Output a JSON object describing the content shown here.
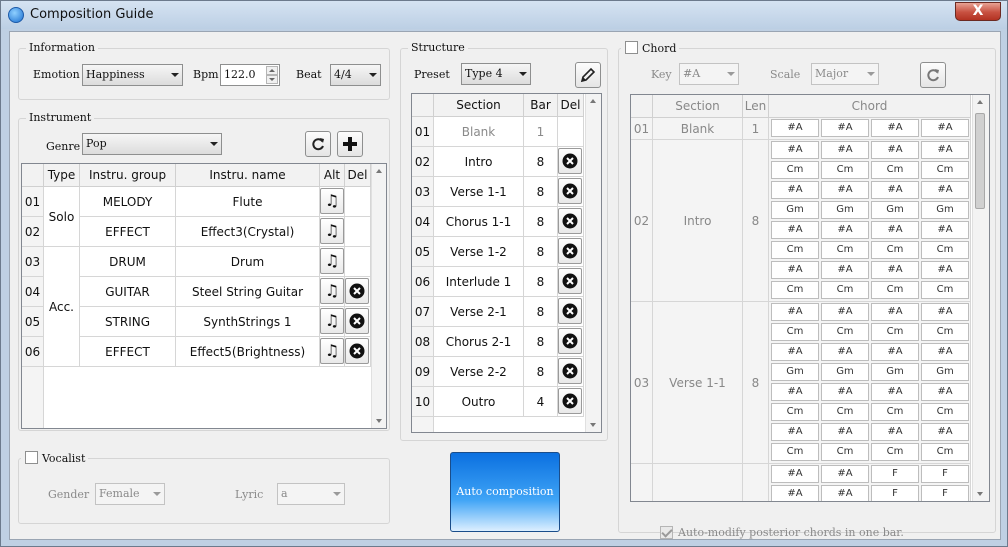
{
  "window": {
    "title": "Composition Guide",
    "close_label": "X"
  },
  "information": {
    "title": "Information",
    "emotion_label": "Emotion",
    "emotion_value": "Happiness",
    "bpm_label": "Bpm",
    "bpm_value": "122.0",
    "beat_label": "Beat",
    "beat_value": "4/4"
  },
  "instrument": {
    "title": "Instrument",
    "genre_label": "Genre",
    "genre_value": "Pop",
    "columns": [
      "Type",
      "Instru. group",
      "Instru. name",
      "Alt",
      "Del"
    ],
    "type_groups": [
      "Solo",
      "Acc."
    ],
    "rows": [
      {
        "no": "01",
        "group": "MELODY",
        "name": "Flute",
        "del": false
      },
      {
        "no": "02",
        "group": "EFFECT",
        "name": "Effect3(Crystal)",
        "del": false
      },
      {
        "no": "03",
        "group": "DRUM",
        "name": "Drum",
        "del": false
      },
      {
        "no": "04",
        "group": "GUITAR",
        "name": "Steel String Guitar",
        "del": true
      },
      {
        "no": "05",
        "group": "STRING",
        "name": "SynthStrings 1",
        "del": true
      },
      {
        "no": "06",
        "group": "EFFECT",
        "name": "Effect5(Brightness)",
        "del": true
      }
    ]
  },
  "vocalist": {
    "title": "Vocalist",
    "gender_label": "Gender",
    "gender_value": "Female",
    "lyric_label": "Lyric",
    "lyric_value": "a"
  },
  "structure": {
    "title": "Structure",
    "preset_label": "Preset",
    "preset_value": "Type 4",
    "columns": [
      "Section",
      "Bar",
      "Del"
    ],
    "rows": [
      {
        "no": "01",
        "section": "Blank",
        "bar": "1",
        "disabled": true
      },
      {
        "no": "02",
        "section": "Intro",
        "bar": "8"
      },
      {
        "no": "03",
        "section": "Verse 1-1",
        "bar": "8"
      },
      {
        "no": "04",
        "section": "Chorus 1-1",
        "bar": "8"
      },
      {
        "no": "05",
        "section": "Verse 1-2",
        "bar": "8"
      },
      {
        "no": "06",
        "section": "Interlude 1",
        "bar": "8"
      },
      {
        "no": "07",
        "section": "Verse 2-1",
        "bar": "8"
      },
      {
        "no": "08",
        "section": "Chorus 2-1",
        "bar": "8"
      },
      {
        "no": "09",
        "section": "Verse 2-2",
        "bar": "8"
      },
      {
        "no": "10",
        "section": "Outro",
        "bar": "4"
      }
    ]
  },
  "auto_composition_label": "Auto composition",
  "chord": {
    "title": "Chord",
    "key_label": "Key",
    "key_value": "#A",
    "scale_label": "Scale",
    "scale_value": "Major",
    "columns": [
      "Section",
      "Len",
      "Chord"
    ],
    "auto_modify_label": "Auto-modify posterior chords in one bar.",
    "blocks": [
      {
        "no": "01",
        "section": "Blank",
        "len": "1",
        "rows": [
          [
            "#A",
            "#A",
            "#A",
            "#A"
          ]
        ]
      },
      {
        "no": "02",
        "section": "Intro",
        "len": "8",
        "rows": [
          [
            "#A",
            "#A",
            "#A",
            "#A"
          ],
          [
            "Cm",
            "Cm",
            "Cm",
            "Cm"
          ],
          [
            "#A",
            "#A",
            "#A",
            "#A"
          ],
          [
            "Gm",
            "Gm",
            "Gm",
            "Gm"
          ],
          [
            "#A",
            "#A",
            "#A",
            "#A"
          ],
          [
            "Cm",
            "Cm",
            "Cm",
            "Cm"
          ],
          [
            "#A",
            "#A",
            "#A",
            "#A"
          ],
          [
            "Cm",
            "Cm",
            "Cm",
            "Cm"
          ]
        ]
      },
      {
        "no": "03",
        "section": "Verse 1-1",
        "len": "8",
        "rows": [
          [
            "#A",
            "#A",
            "#A",
            "#A"
          ],
          [
            "Cm",
            "Cm",
            "Cm",
            "Cm"
          ],
          [
            "#A",
            "#A",
            "#A",
            "#A"
          ],
          [
            "Gm",
            "Gm",
            "Gm",
            "Gm"
          ],
          [
            "#A",
            "#A",
            "#A",
            "#A"
          ],
          [
            "Cm",
            "Cm",
            "Cm",
            "Cm"
          ],
          [
            "#A",
            "#A",
            "#A",
            "#A"
          ],
          [
            "Cm",
            "Cm",
            "Cm",
            "Cm"
          ]
        ]
      },
      {
        "no": "",
        "section": "",
        "len": "",
        "rows": [
          [
            "#A",
            "#A",
            "F",
            "F"
          ],
          [
            "#A",
            "#A",
            "F",
            "F"
          ]
        ]
      }
    ]
  },
  "icons": {
    "refresh": "refresh-icon",
    "add": "plus-icon",
    "edit": "pencil-icon",
    "alt": "music-note-icon",
    "delete": "x-circle-icon"
  }
}
